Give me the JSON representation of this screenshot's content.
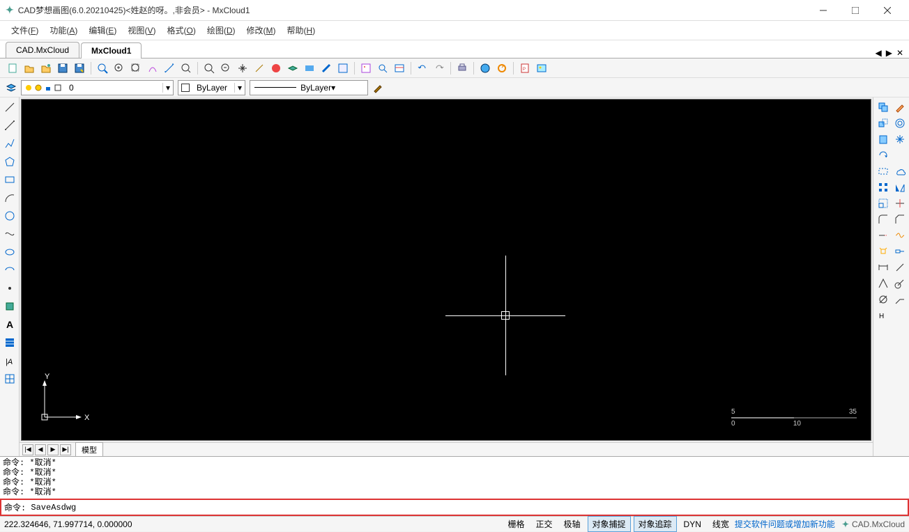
{
  "title": "CAD梦想画图(6.0.20210425)<姓赵的呀。,非会员> - MxCloud1",
  "menus": [
    {
      "label": "文件",
      "key": "F"
    },
    {
      "label": "功能",
      "key": "A"
    },
    {
      "label": "编辑",
      "key": "E"
    },
    {
      "label": "视图",
      "key": "V"
    },
    {
      "label": "格式",
      "key": "O"
    },
    {
      "label": "绘图",
      "key": "D"
    },
    {
      "label": "修改",
      "key": "M"
    },
    {
      "label": "帮助",
      "key": "H"
    }
  ],
  "tabs": [
    {
      "label": "CAD.MxCloud",
      "active": false
    },
    {
      "label": "MxCloud1",
      "active": true
    }
  ],
  "layer": {
    "value": "0"
  },
  "color_combo": "ByLayer",
  "linetype_combo": "ByLayer",
  "model_tab": "模型",
  "ruler": {
    "top_left": "5",
    "top_right": "35",
    "bot_left": "0",
    "bot_right": "10"
  },
  "ucs_x": "X",
  "ucs_y": "Y",
  "command_history": [
    "命令: *取消*",
    "命令: *取消*",
    "命令: *取消*",
    "命令: *取消*"
  ],
  "command_prompt": "命令: ",
  "command_value": "SaveAsdwg",
  "coords": "222.324646, 71.997714, 0.000000",
  "status_buttons": [
    {
      "label": "栅格",
      "active": false
    },
    {
      "label": "正交",
      "active": false
    },
    {
      "label": "极轴",
      "active": false
    },
    {
      "label": "对象捕捉",
      "active": true
    },
    {
      "label": "对象追踪",
      "active": true
    },
    {
      "label": "DYN",
      "active": false
    },
    {
      "label": "线宽",
      "active": false
    }
  ],
  "feedback_link": "提交软件问题或增加新功能",
  "brand": "CAD.MxCloud"
}
